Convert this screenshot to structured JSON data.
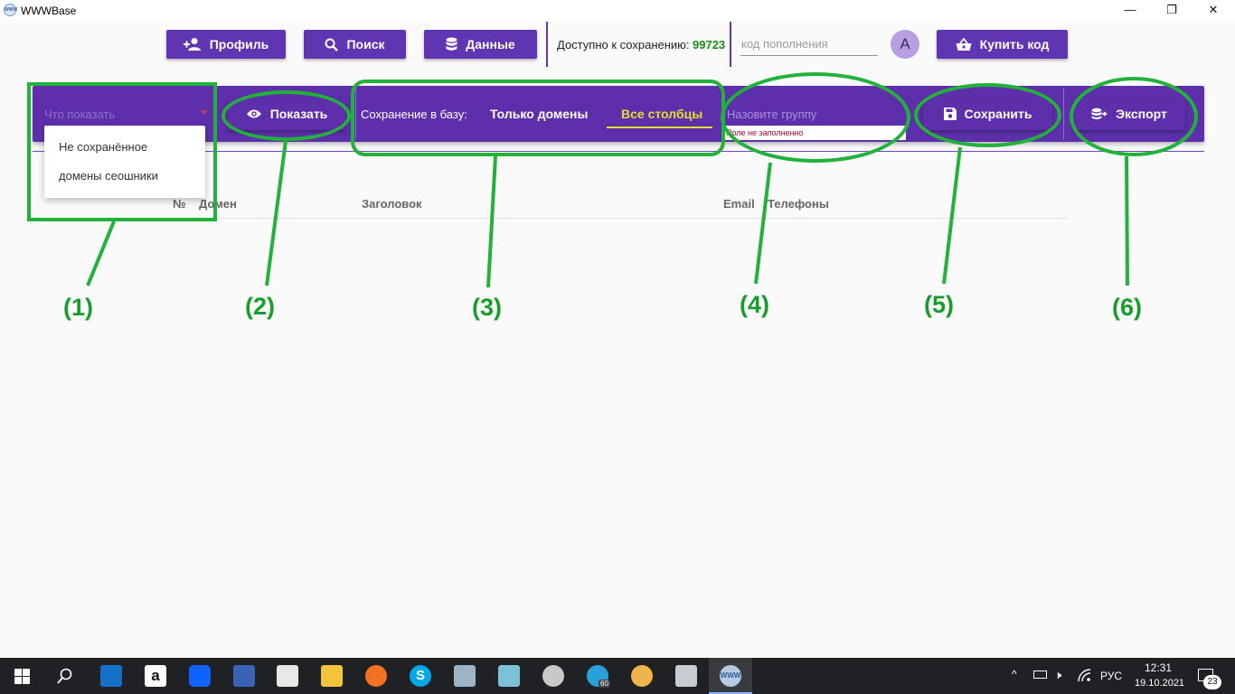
{
  "window": {
    "title": "WWWBase",
    "app_icon_text": "WWW",
    "minimize_glyph": "—",
    "maximize_glyph": "❐",
    "close_glyph": "✕"
  },
  "header": {
    "profile_label": "Профиль",
    "search_label": "Поиск",
    "data_label": "Данные",
    "available_label": "Доступно к сохранению:",
    "available_value": "99723",
    "code_placeholder": "код пополнения",
    "avatar_letter": "A",
    "buy_label": "Купить код"
  },
  "toolbar": {
    "select_placeholder": "Что показать",
    "options": [
      "Не сохранённое",
      "домены сеошники"
    ],
    "show_label": "Показать",
    "save_to_db_label": "Сохранение в базу:",
    "tab_domains": "Только домены",
    "tab_all_columns": "Все столбцы",
    "active_tab": "Все столбцы",
    "group_placeholder": "Назовите группу",
    "group_error": "Поле не заполненно",
    "save_label": "Сохранить",
    "export_label": "Экспорт"
  },
  "table": {
    "columns": [
      "№",
      "Домен",
      "Заголовок",
      "Email",
      "Телефоны"
    ]
  },
  "annotations": [
    "(1)",
    "(2)",
    "(3)",
    "(4)",
    "(5)",
    "(6)"
  ],
  "taskbar": {
    "language": "РУС",
    "time": "12:31",
    "date": "19.10.2021",
    "notification_count": "23",
    "telegram_badge": "60"
  },
  "colors": {
    "primary": "#5d2fab",
    "accent_tab": "#e5dc34",
    "available_value": "#168c17",
    "annotation_green": "#22b13a",
    "error": "#b2002d"
  }
}
